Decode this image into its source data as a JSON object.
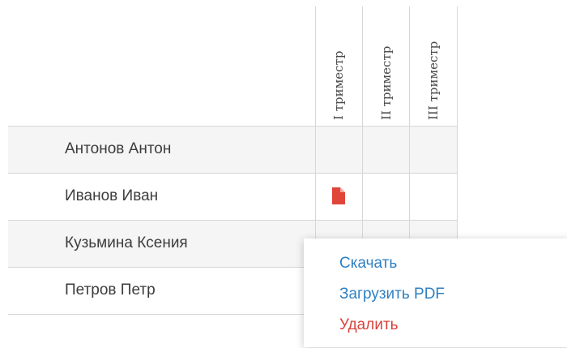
{
  "table": {
    "columns": [
      "I триместр",
      "II триместр",
      "III триместр"
    ],
    "rows": [
      {
        "name": "Антонов Антон",
        "files": [
          false,
          false,
          false
        ]
      },
      {
        "name": "Иванов Иван",
        "files": [
          true,
          false,
          false
        ]
      },
      {
        "name": "Кузьмина Ксения",
        "files": [
          false,
          false,
          false
        ]
      },
      {
        "name": "Петров Петр",
        "files": [
          false,
          false,
          false
        ]
      }
    ]
  },
  "icons": {
    "file": "file-pdf-icon"
  },
  "colors": {
    "link": "#2f80c2",
    "danger": "#d9403a",
    "file_icon": "#e0453a",
    "row_shade": "#f5f5f5",
    "grid": "#d6d6d6"
  },
  "context_menu": {
    "download_label": "Скачать",
    "upload_label": "Загрузить PDF",
    "delete_label": "Удалить"
  }
}
